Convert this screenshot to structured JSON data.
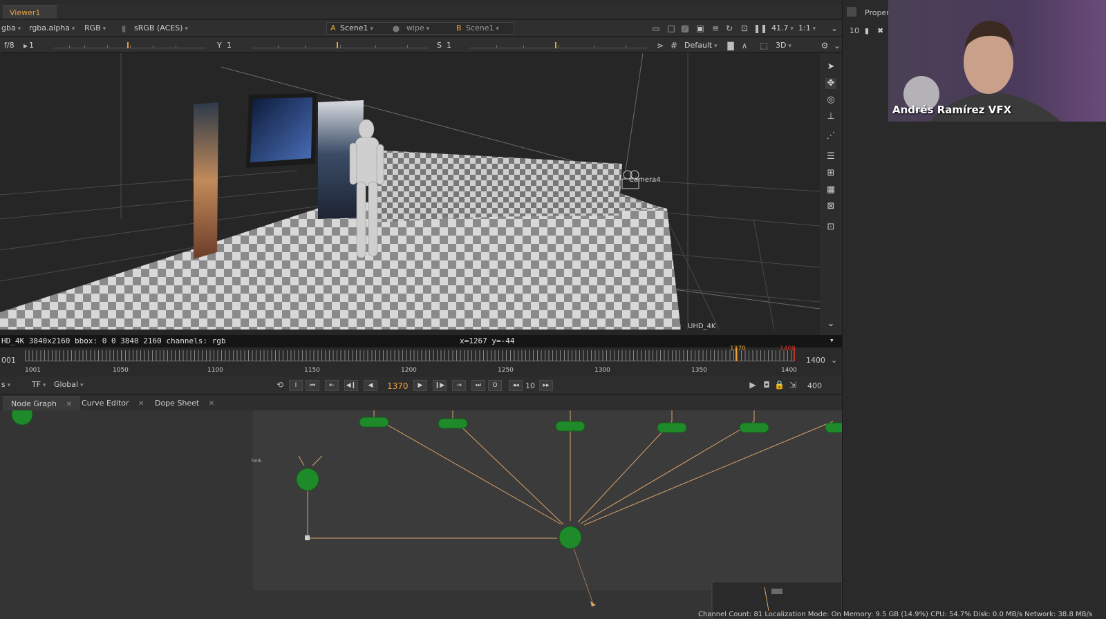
{
  "viewer": {
    "tab_label": "Viewer1",
    "close_glyph": "✕",
    "toolbar": {
      "channel_partial": "gba",
      "alpha_channel": "rgba.alpha",
      "display_channels": "RGB",
      "colorspace": "sRGB (ACES)",
      "input_a_letter": "A",
      "input_a": "Scene1",
      "wipe_mode": "wipe",
      "input_b_letter": "B",
      "input_b": "Scene1",
      "zoom": "41.7",
      "ratio": "1:1"
    },
    "toolbar2": {
      "fstop": "f/8",
      "frame_value": "1",
      "gamma_label": "Y",
      "gamma_value": "1",
      "saturation_label": "S",
      "saturation_value": "1",
      "lut": "Default",
      "view_mode": "3D"
    },
    "viewport": {
      "camera_label": "Camera4",
      "format_label": "UHD_4K"
    },
    "info_bar": {
      "format_info": "HD_4K 3840x2160  bbox: 0 0 3840 2160 channels: rgb",
      "coordinates": "x=1267 y=-44"
    }
  },
  "timeline": {
    "start_frame": "001",
    "end_frame": "1400",
    "ticks": [
      "1001",
      "1050",
      "1100",
      "1150",
      "1200",
      "1250",
      "1300",
      "1350",
      "1400"
    ],
    "current_frame_marker": "1370",
    "out_point_marker": "1400",
    "current_frame": "1370",
    "increment": "10",
    "frame_range_count": "400",
    "fps_partial": "s",
    "time_format": "TF",
    "range_mode": "Global"
  },
  "bottom_tabs": [
    {
      "label": "Node Graph"
    },
    {
      "label": "Curve Editor"
    },
    {
      "label": "Dope Sheet"
    }
  ],
  "node_graph": {
    "small_label": "look"
  },
  "right_panel": {
    "tab_label_partial": "Proper",
    "counter": "10"
  },
  "webcam": {
    "name_overlay": "Andrés Ramírez VFX"
  },
  "status": "Channel Count: 81  Localization Mode: On  Memory: 9.5 GB (14.9%)  CPU: 54.7%  Disk: 0.0 MB/s  Network: 38.8 MB/s",
  "colors": {
    "accent": "#e8a23c",
    "node_green": "#1f8a2a",
    "pipe": "#d9a46a"
  }
}
